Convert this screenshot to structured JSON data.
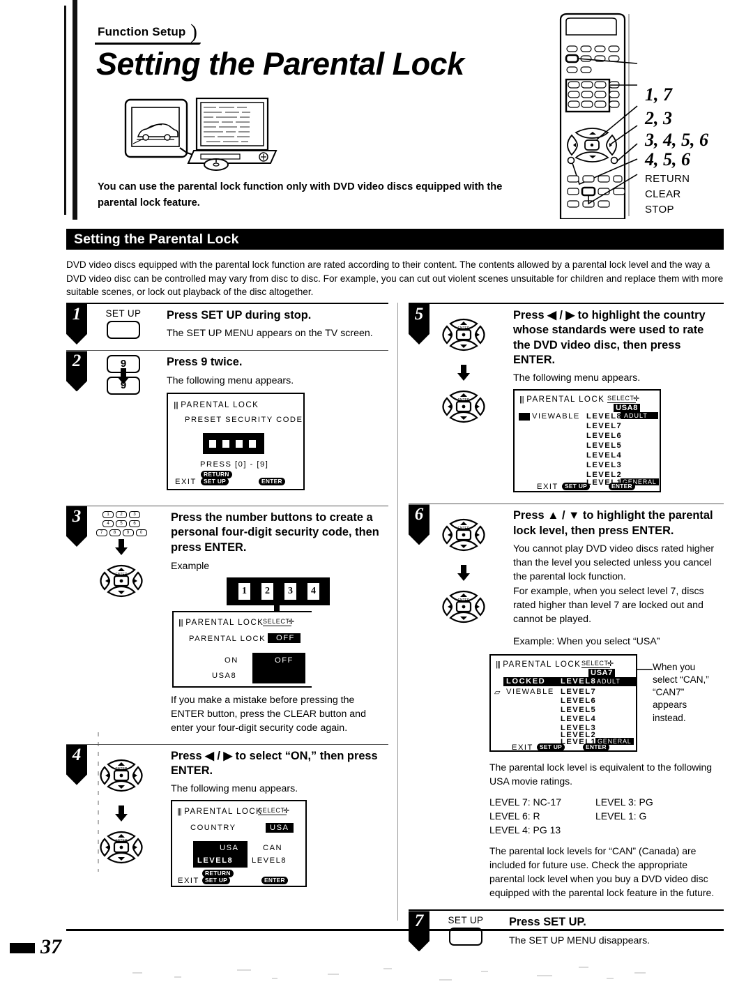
{
  "header": {
    "tab_label": "Function Setup",
    "title": "Setting the Parental Lock",
    "intro_bold": "You can use the parental lock function only with DVD video discs equipped with the parental lock feature."
  },
  "remote_callouts": [
    {
      "text": "1, 7",
      "type": "number"
    },
    {
      "text": "2, 3",
      "type": "number"
    },
    {
      "text": "3, 4, 5, 6",
      "type": "number"
    },
    {
      "text": "4, 5, 6",
      "type": "number"
    },
    {
      "text": "RETURN",
      "type": "word"
    },
    {
      "text": "CLEAR",
      "type": "word"
    },
    {
      "text": "STOP",
      "type": "word"
    }
  ],
  "section": {
    "bar_title": "Setting the Parental Lock",
    "intro": "DVD video discs equipped with the parental lock function are rated according to their content. The contents allowed by a parental lock level and the way a DVD video disc can be controlled may vary from disc to disc. For example, you can cut out violent scenes unsuitable for children and replace them with more suitable scenes, or lock out playback of the disc altogether."
  },
  "steps": {
    "s1": {
      "num": "1",
      "key_label": "SET UP",
      "heading": "Press SET UP during stop.",
      "sub": "The SET UP MENU appears on the TV screen."
    },
    "s2": {
      "num": "2",
      "key_top": "9",
      "key_bottom": "9",
      "heading": "Press 9 twice.",
      "sub": "The following menu appears.",
      "osd": {
        "title": "PARENTAL  LOCK",
        "line1": "PRESET  SECURITY  CODE",
        "press_hint": "PRESS  [0] - [9]",
        "exit_label": "EXIT",
        "return_pill": "RETURN",
        "setup_pill": "SET UP",
        "enter_pill": "ENTER"
      }
    },
    "s3": {
      "num": "3",
      "numpad": [
        "1",
        "2",
        "3",
        "4",
        "5",
        "6",
        "7",
        "8",
        "9",
        "0"
      ],
      "heading": "Press the number buttons to create a personal four-digit security code, then press ENTER.",
      "example_label": "Example",
      "code_digits": [
        "1",
        "2",
        "3",
        "4"
      ],
      "osd": {
        "title": "PARENTAL  LOCK",
        "select_label": "SELECT:",
        "row_label": "PARENTAL  LOCK",
        "row_value": "OFF",
        "option_on": "ON",
        "option_off": "OFF",
        "country_level": "USA8"
      },
      "footnote": "If you make a mistake before pressing the ENTER button, press the CLEAR button and enter your four-digit security code again."
    },
    "s4": {
      "num": "4",
      "heading": "Press ◀ / ▶ to select “ON,” then press ENTER.",
      "sub": "The following menu appears.",
      "osd": {
        "title": "PARENTAL  LOCK",
        "select_label": "SELECT:",
        "row_label": "COUNTRY",
        "row_value": "USA",
        "col1_country": "USA",
        "col1_level": "LEVEL8",
        "col2_country": "CAN",
        "col2_level": "LEVEL8",
        "exit_label": "EXIT",
        "return_pill": "RETURN",
        "setup_pill": "SET UP",
        "enter_pill": "ENTER"
      }
    },
    "s5": {
      "num": "5",
      "heading": "Press ◀ / ▶ to highlight the country whose standards were used to rate the DVD video disc, then press ENTER.",
      "sub": "The following menu appears.",
      "osd": {
        "title": "PARENTAL  LOCK",
        "select_label": "SELECT:",
        "country_code": "USA8",
        "status_label": "VIEWABLE",
        "levels": [
          "LEVEL8",
          "LEVEL7",
          "LEVEL6",
          "LEVEL5",
          "LEVEL4",
          "LEVEL3",
          "LEVEL2",
          "LEVEL1"
        ],
        "top_tag": "ADULT",
        "bottom_tag": "GENERAL",
        "exit_label": "EXIT",
        "setup_pill": "SET UP",
        "enter_pill": "ENTER"
      }
    },
    "s6": {
      "num": "6",
      "heading": "Press ▲ / ▼ to highlight the parental lock level, then press ENTER.",
      "sub1": "You cannot play DVD video discs rated higher than the level you selected unless you cancel the parental lock function.",
      "sub2": "For example, when you select level 7, discs rated higher than level 7 are locked out and cannot be played.",
      "example_line": "Example:  When you select “USA”",
      "osd": {
        "title": "PARENTAL  LOCK",
        "select_label": "SELECT:",
        "country_code": "USA7",
        "locked_label": "LOCKED",
        "locked_level": "LEVEL8",
        "locked_tag": "ADULT",
        "viewable_label": "VIEWABLE",
        "levels": [
          "LEVEL7",
          "LEVEL6",
          "LEVEL5",
          "LEVEL4",
          "LEVEL3",
          "LEVEL2",
          "LEVEL1"
        ],
        "bottom_tag": "GENERAL",
        "exit_label": "EXIT",
        "setup_pill": "SET UP",
        "enter_pill": "ENTER"
      },
      "callout": "When you select “CAN,” “CAN7” appears instead.",
      "ratings_intro": "The parental lock level is equivalent to the following USA movie ratings.",
      "ratings": [
        {
          "left": "LEVEL 7:  NC-17",
          "right": "LEVEL 3:  PG"
        },
        {
          "left": "LEVEL 6:  R",
          "right": "LEVEL 1:  G"
        },
        {
          "left": "LEVEL 4:  PG 13",
          "right": ""
        }
      ],
      "closing_note": "The parental lock levels for “CAN” (Canada) are included for future use. Check the appropriate parental lock level when you buy a DVD video disc equipped with the parental lock feature in the future."
    },
    "s7": {
      "num": "7",
      "key_label": "SET UP",
      "heading": "Press SET UP.",
      "sub": "The SET UP MENU disappears."
    }
  },
  "footer": {
    "page_number": "37"
  }
}
